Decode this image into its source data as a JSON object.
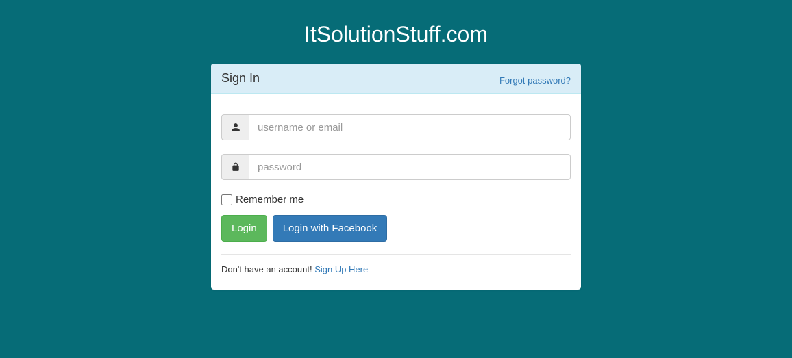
{
  "site": {
    "title": "ItSolutionStuff.com"
  },
  "panel": {
    "header_title": "Sign In",
    "forgot_link": "Forgot password?"
  },
  "form": {
    "username_placeholder": "username or email",
    "password_placeholder": "password",
    "remember_label": "Remember me",
    "login_button": "Login",
    "facebook_button": "Login with Facebook"
  },
  "footer": {
    "text": "Don't have an account! ",
    "signup_link": "Sign Up Here"
  }
}
